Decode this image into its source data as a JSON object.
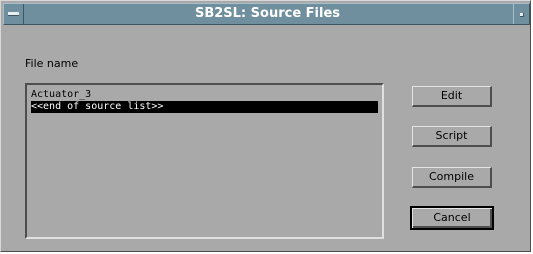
{
  "window": {
    "title": "SB2SL: Source Files"
  },
  "form": {
    "file_name_label": "File name"
  },
  "source_list": {
    "items": [
      {
        "text": "Actuator_3",
        "selected": false
      },
      {
        "text": "<<end of source list>>",
        "selected": true
      }
    ]
  },
  "buttons": {
    "edit": "Edit",
    "script": "Script",
    "compile": "Compile",
    "cancel": "Cancel"
  },
  "colors": {
    "background": "#a9a9a9",
    "titlebar": "#6f8f9e",
    "title_text": "#ffffff",
    "selection": "#000000"
  },
  "icons": {
    "window_menu": "window-menu-icon",
    "minimize": "minimize-icon"
  }
}
